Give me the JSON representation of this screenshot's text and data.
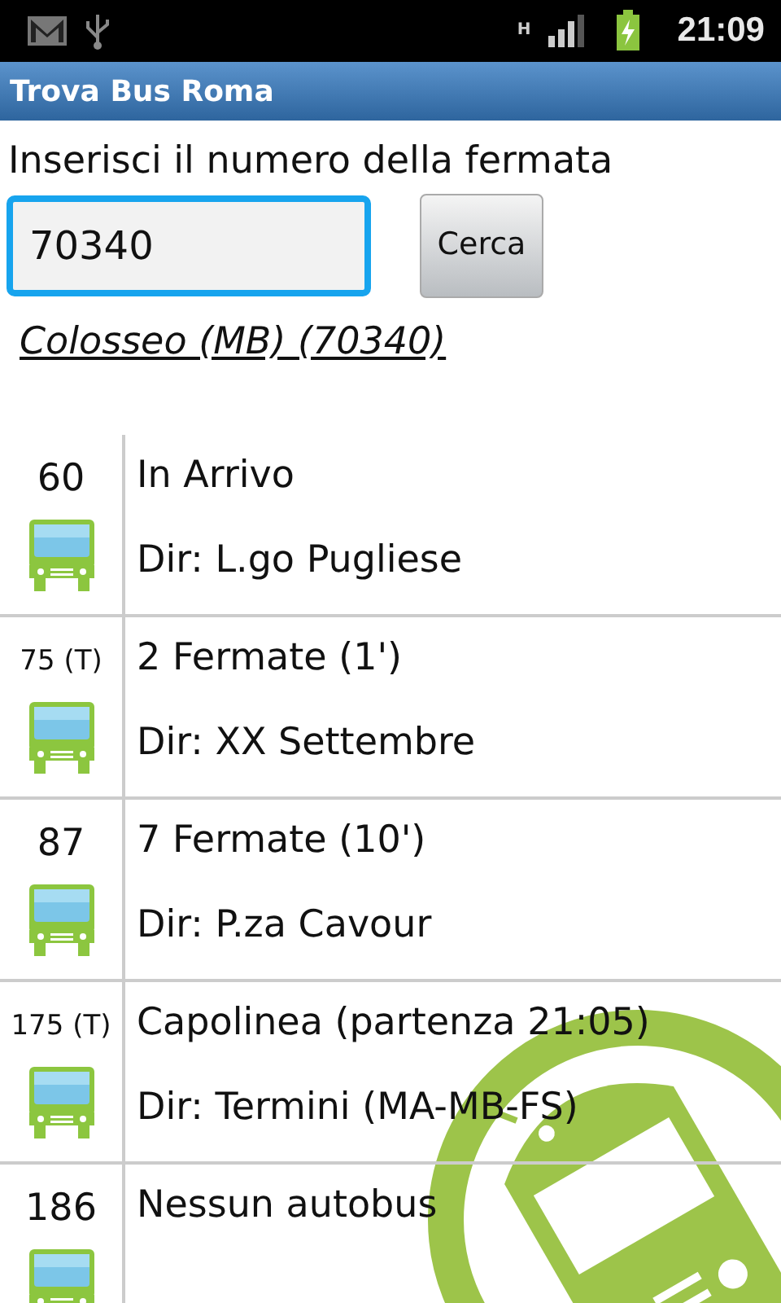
{
  "status_bar": {
    "network_type": "H",
    "time": "21:09"
  },
  "title_bar": {
    "title": "Trova Bus Roma"
  },
  "search": {
    "label": "Inserisci il numero della fermata",
    "value": "70340",
    "button": "Cerca"
  },
  "stop_link": "Colosseo (MB) (70340)",
  "arrivals": [
    {
      "route": "60",
      "status": "In Arrivo",
      "direction": "Dir: L.go Pugliese"
    },
    {
      "route": "75 (T)",
      "status": "2 Fermate (1')",
      "direction": "Dir: XX Settembre"
    },
    {
      "route": "87",
      "status": "7 Fermate (10')",
      "direction": "Dir: P.za Cavour"
    },
    {
      "route": "175 (T)",
      "status": "Capolinea (partenza 21:05)",
      "direction": "Dir: Termini (MA-MB-FS)"
    },
    {
      "route": "186",
      "status": "Nessun autobus"
    }
  ]
}
